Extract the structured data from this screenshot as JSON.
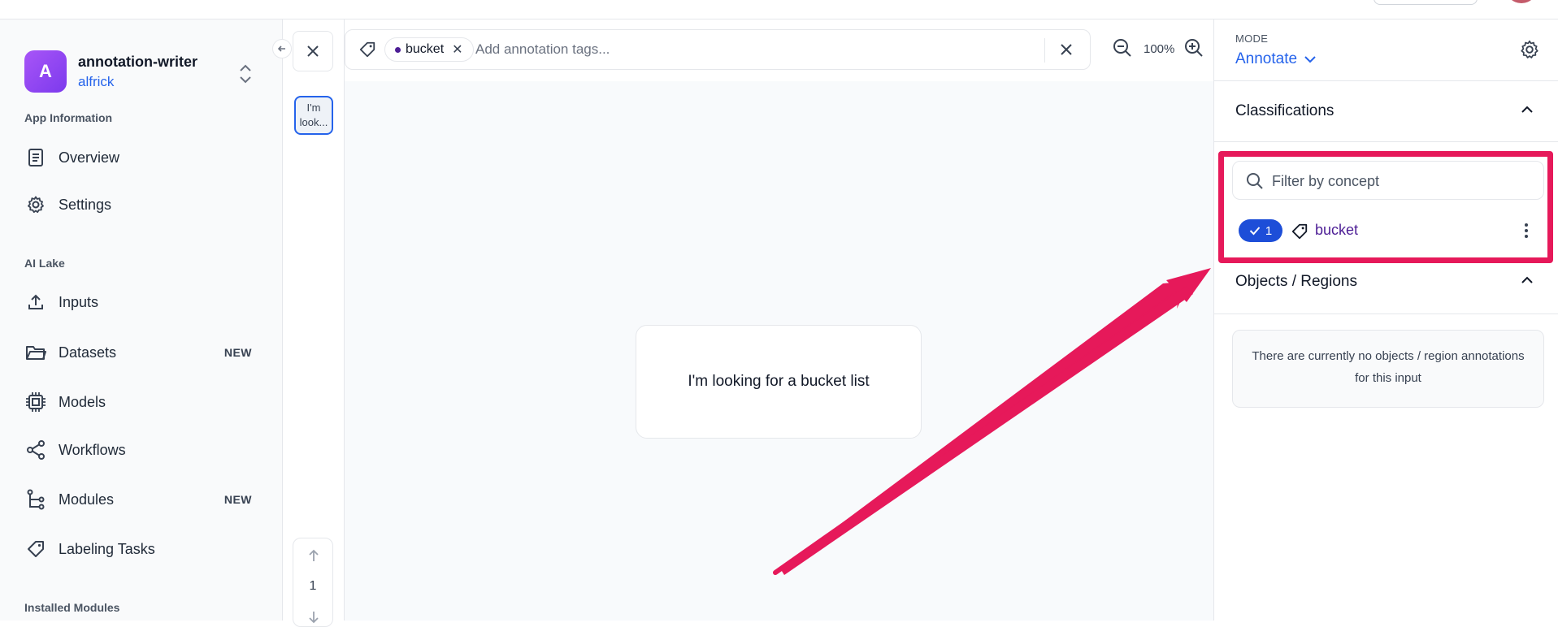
{
  "app": {
    "avatar_letter": "A",
    "name": "annotation-writer",
    "user": "alfrick"
  },
  "sidebar": {
    "sections": [
      {
        "title": "App Information"
      },
      {
        "title": "AI Lake"
      },
      {
        "title": "Installed Modules"
      }
    ],
    "items": [
      {
        "label": "Overview",
        "icon": "document-icon",
        "badge": ""
      },
      {
        "label": "Settings",
        "icon": "gear-icon",
        "badge": ""
      },
      {
        "label": "Inputs",
        "icon": "upload-icon",
        "badge": ""
      },
      {
        "label": "Datasets",
        "icon": "folder-icon",
        "badge": "NEW"
      },
      {
        "label": "Models",
        "icon": "chip-icon",
        "badge": ""
      },
      {
        "label": "Workflows",
        "icon": "share-icon",
        "badge": ""
      },
      {
        "label": "Modules",
        "icon": "branch-icon",
        "badge": "NEW"
      },
      {
        "label": "Labeling Tasks",
        "icon": "tag-icon",
        "badge": ""
      }
    ]
  },
  "thumbnails": {
    "current_thumb_text": "I'm look...",
    "page_number": "1"
  },
  "toolbar": {
    "chip_label": "bucket",
    "tag_placeholder": "Add annotation tags...",
    "zoom_level": "100%"
  },
  "canvas": {
    "input_text": "I'm looking for a bucket list"
  },
  "right_panel": {
    "mode_label": "MODE",
    "mode_value": "Annotate",
    "classifications_title": "Classifications",
    "filter_placeholder": "Filter by concept",
    "concept": {
      "count": "1",
      "name": "bucket"
    },
    "objects_title": "Objects / Regions",
    "empty_message": "There are currently no objects / region annotations for this input"
  },
  "colors": {
    "accent": "#2563eb",
    "highlight": "#e6195a",
    "concept_text": "#4c1d95"
  }
}
